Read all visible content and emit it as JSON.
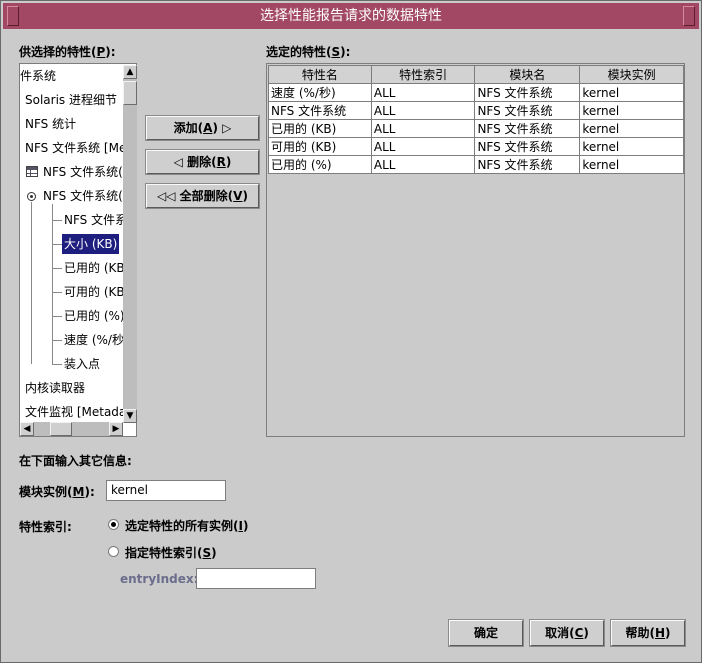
{
  "window": {
    "title": "选择性能报告请求的数据特性"
  },
  "available": {
    "label": "供选择的特性(",
    "label_key": "P",
    "label_end": "):",
    "tree": [
      {
        "text": "件系统"
      },
      {
        "text": "Solaris 进程细节"
      },
      {
        "text": "NFS 统计"
      },
      {
        "text": "NFS 文件系统 [Me"
      },
      {
        "text": "NFS 文件系统("
      },
      {
        "text": "NFS 文件系统("
      },
      {
        "text": "NFS 文件系"
      },
      {
        "text": "大小 (KB)"
      },
      {
        "text": "已用的 (KB"
      },
      {
        "text": "可用的 (KB"
      },
      {
        "text": "已用的 (%)"
      },
      {
        "text": "速度 (%/秒"
      },
      {
        "text": "装入点"
      },
      {
        "text": "内核读取器"
      },
      {
        "text": "文件监视 [Metadat"
      }
    ]
  },
  "actions": {
    "add": "添加(",
    "add_key": "A",
    "add_end": ") ▷",
    "remove": "◁ 删除(",
    "remove_key": "R",
    "remove_end": ")",
    "remove_all": "◁◁ 全部删除(",
    "remove_all_key": "V",
    "remove_all_end": ")"
  },
  "selected": {
    "label": "选定的特性(",
    "label_key": "S",
    "label_end": "):",
    "columns": [
      "特性名",
      "特性索引",
      "模块名",
      "模块实例"
    ],
    "rows": [
      [
        "速度 (%/秒)",
        "ALL",
        "NFS 文件系统",
        "kernel"
      ],
      [
        "NFS 文件系统",
        "ALL",
        "NFS 文件系统",
        "kernel"
      ],
      [
        "已用的 (KB)",
        "ALL",
        "NFS 文件系统",
        "kernel"
      ],
      [
        "可用的 (KB)",
        "ALL",
        "NFS 文件系统",
        "kernel"
      ],
      [
        "已用的 (%)",
        "ALL",
        "NFS 文件系统",
        "kernel"
      ]
    ]
  },
  "extra": {
    "heading": "在下面输入其它信息:",
    "module_instance_label": "模块实例(",
    "module_instance_key": "M",
    "module_instance_end": "):",
    "module_instance_value": "kernel",
    "attr_index_label": "特性索引:",
    "radio_all": "选定特性的所有实例(",
    "radio_all_key": "I",
    "radio_all_end": ")",
    "radio_specific": "指定特性索引(",
    "radio_specific_key": "S",
    "radio_specific_end": ")",
    "entry_index_label": "entryIndex:",
    "entry_index_value": ""
  },
  "footer": {
    "ok": "确定",
    "cancel": "取消(",
    "cancel_key": "C",
    "cancel_end": ")",
    "help": "帮助(",
    "help_key": "H",
    "help_end": ")"
  }
}
